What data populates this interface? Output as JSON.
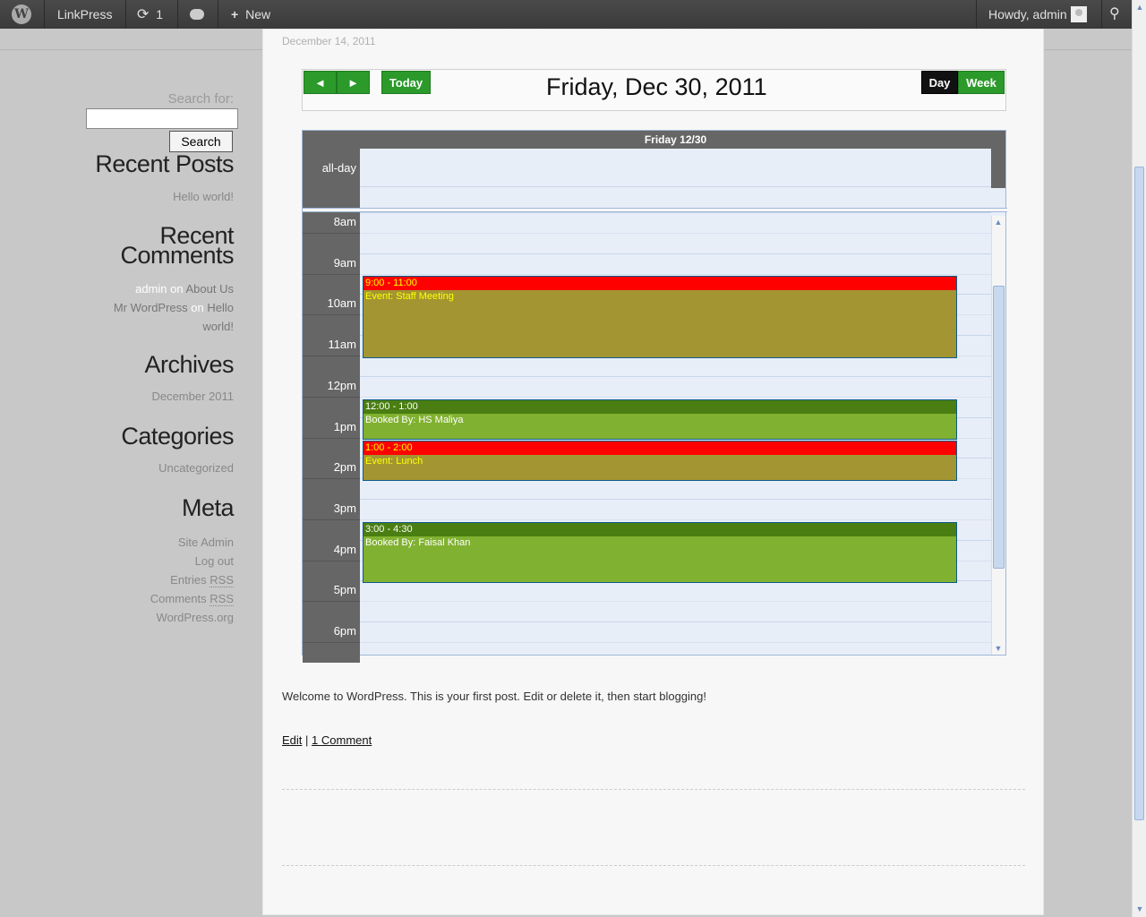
{
  "adminbar": {
    "site_name": "LinkPress",
    "updates_count": "1",
    "new_label": "New",
    "greeting": "Howdy, admin"
  },
  "sidebar": {
    "search_label": "Search for:",
    "search_value": "",
    "search_button": "Search",
    "recent_posts_title": "Recent Posts",
    "recent_posts": [
      "Hello world!"
    ],
    "recent_comments_title_1": "Recent",
    "recent_comments_title_2": "Comments",
    "comments": [
      {
        "author": "admin",
        "on": "on",
        "post": "About Us"
      },
      {
        "author": "Mr WordPress",
        "on": "on",
        "post_1": "Hello",
        "post_2": "world!"
      }
    ],
    "archives_title": "Archives",
    "archives": [
      "December 2011"
    ],
    "categories_title": "Categories",
    "categories": [
      "Uncategorized"
    ],
    "meta_title": "Meta",
    "meta": [
      "Site Admin",
      "Log out",
      "Entries",
      "Comments",
      "WordPress.org"
    ],
    "rss_label": "RSS"
  },
  "post": {
    "date": "December 14, 2011",
    "text": "Welcome to WordPress. This is your first post. Edit or delete it, then start blogging!",
    "edit_link": "Edit",
    "separator": "|",
    "comments_link": "1 Comment"
  },
  "calendar": {
    "prev_label": "◄",
    "next_label": "►",
    "today_label": "Today",
    "title": "Friday, Dec 30, 2011",
    "day_label": "Day",
    "week_label": "Week",
    "column_header": "Friday 12/30",
    "allday_label": "all-day",
    "hours": [
      "8am",
      "9am",
      "10am",
      "11am",
      "12pm",
      "1pm",
      "2pm",
      "3pm",
      "4pm",
      "5pm",
      "6pm"
    ],
    "events": [
      {
        "time": "9:00 - 11:00",
        "title": "Event: Staff Meeting",
        "color": "#a39632"
      },
      {
        "time": "12:00 - 1:00",
        "title": "Booked By: HS Maliya",
        "color": "#80b130"
      },
      {
        "time": "1:00 - 2:00",
        "title": "Event: Lunch",
        "color": "#a39632"
      },
      {
        "time": "3:00 - 4:30",
        "title": "Booked By: Faisal Khan",
        "color": "#80b130"
      }
    ]
  }
}
